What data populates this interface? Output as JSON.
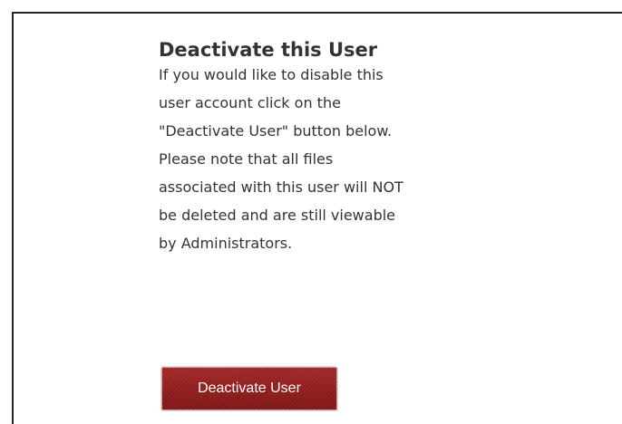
{
  "section": {
    "title": "Deactivate this User",
    "description_lines": [
      "If you would like to disable this",
      "user account click on the",
      "\"Deactivate User\" button below.",
      "Please note that all files",
      "associated with this user will NOT",
      "be deleted and are still viewable",
      "by Administrators."
    ],
    "button_label": "Deactivate User"
  },
  "colors": {
    "button_background": "#8e1b1b",
    "text": "#333333",
    "border": "#222222"
  }
}
